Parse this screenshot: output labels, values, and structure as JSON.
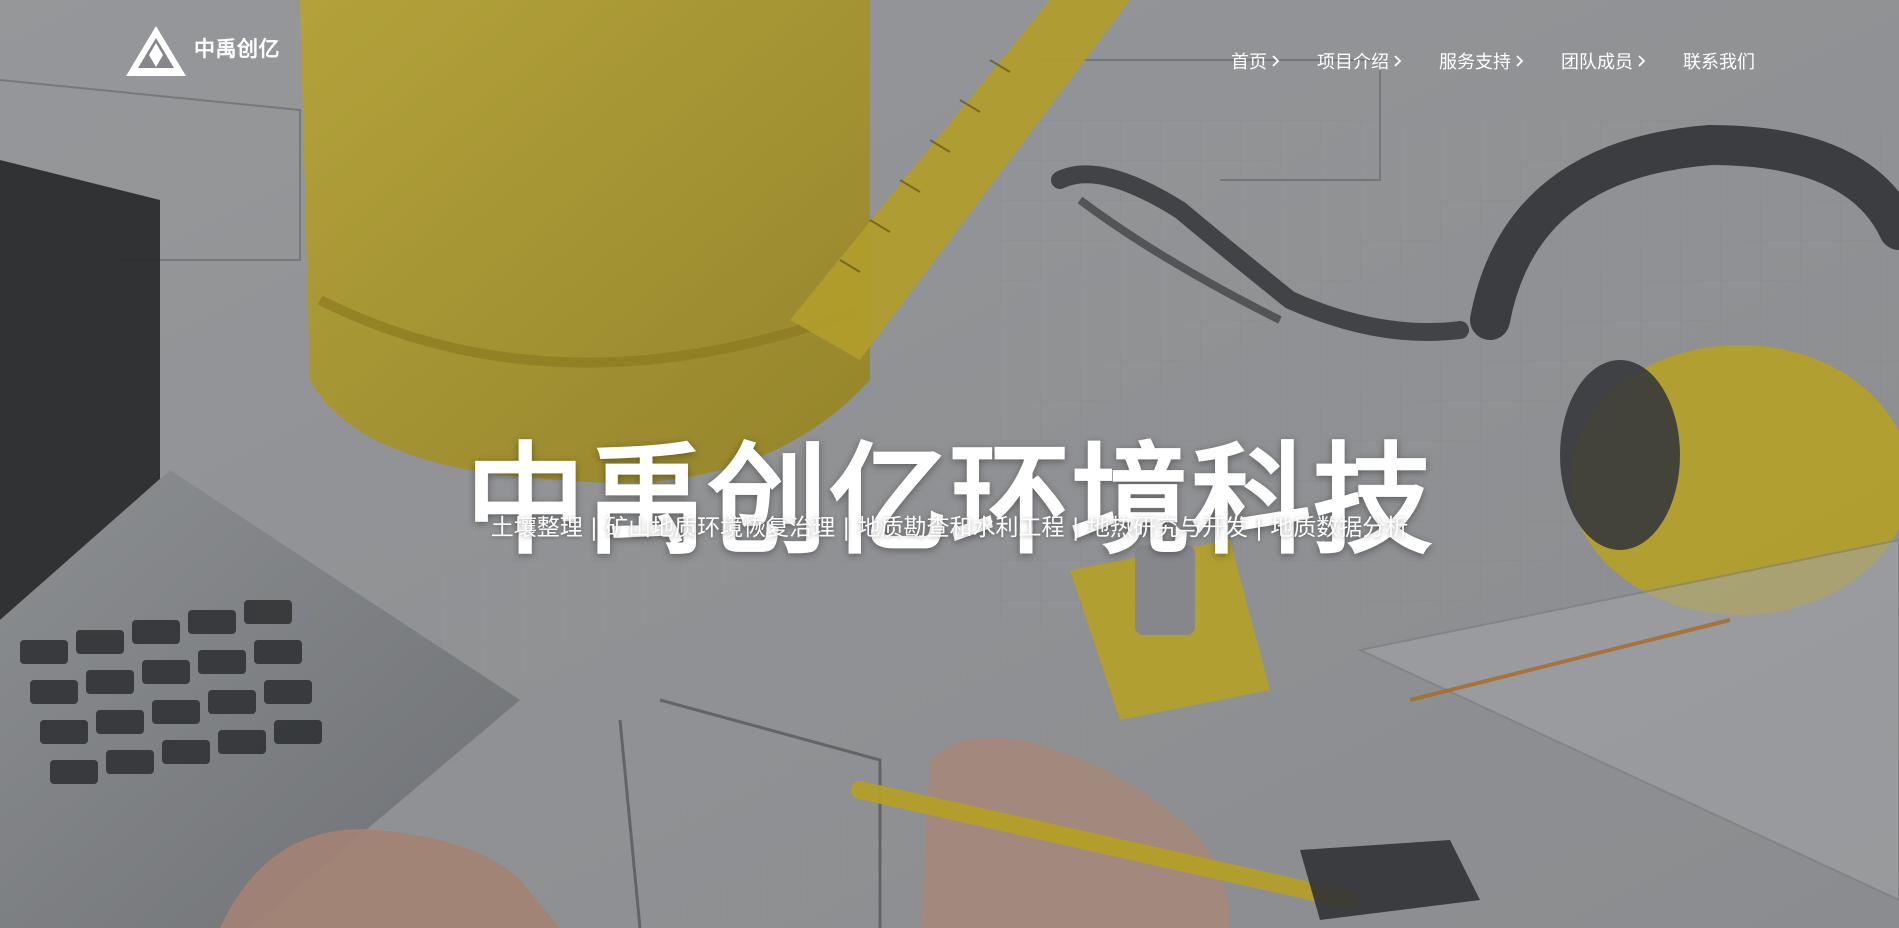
{
  "brand": {
    "name": "中禹创亿",
    "logo_icon": "triangle-logo-icon"
  },
  "nav": {
    "items": [
      {
        "label": "首页",
        "icon": "chevron-right-icon"
      },
      {
        "label": "项目介绍",
        "icon": "chevron-right-icon"
      },
      {
        "label": "服务支持",
        "icon": "chevron-right-icon"
      },
      {
        "label": "团队成员",
        "icon": "chevron-right-icon"
      },
      {
        "label": "联系我们"
      }
    ]
  },
  "hero": {
    "title": "中禹创亿环境科技",
    "subtitle": "土壤整理 | 矿山地质环境恢复治理 | 地质勘查和水利工程 | 地热研究与开发 | 地质数据分析",
    "background_image": "engineering-desk-photo",
    "colors": {
      "accent_yellow": "#e5c21b",
      "overlay": "#5a5c60"
    }
  }
}
